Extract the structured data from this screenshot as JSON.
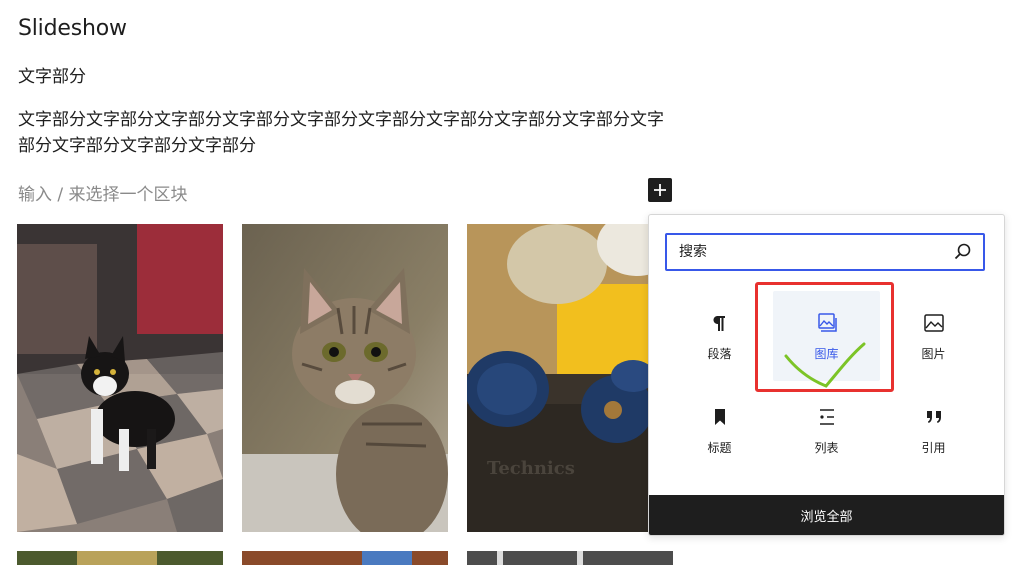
{
  "post": {
    "title": "Slideshow",
    "short_text": "文字部分",
    "paragraph": "文字部分文字部分文字部分文字部分文字部分文字部分文字部分文字部分文字部分文字部分文字部分文字部分文字部分",
    "block_placeholder": "输入 / 来选择一个区块"
  },
  "inserter": {
    "search_placeholder": "搜索",
    "blocks": [
      {
        "id": "paragraph",
        "label": "段落",
        "icon": "pilcrow-icon"
      },
      {
        "id": "gallery",
        "label": "图库",
        "icon": "gallery-icon",
        "active": true
      },
      {
        "id": "image",
        "label": "图片",
        "icon": "image-icon"
      },
      {
        "id": "heading",
        "label": "标题",
        "icon": "bookmark-icon"
      },
      {
        "id": "list",
        "label": "列表",
        "icon": "list-icon"
      },
      {
        "id": "quote",
        "label": "引用",
        "icon": "quote-icon"
      }
    ],
    "browse_all": "浏览全部"
  },
  "colors": {
    "accent": "#3858e9",
    "annotation_red": "#e8312f",
    "annotation_green": "#7cc427",
    "dark": "#1e1e1e"
  }
}
